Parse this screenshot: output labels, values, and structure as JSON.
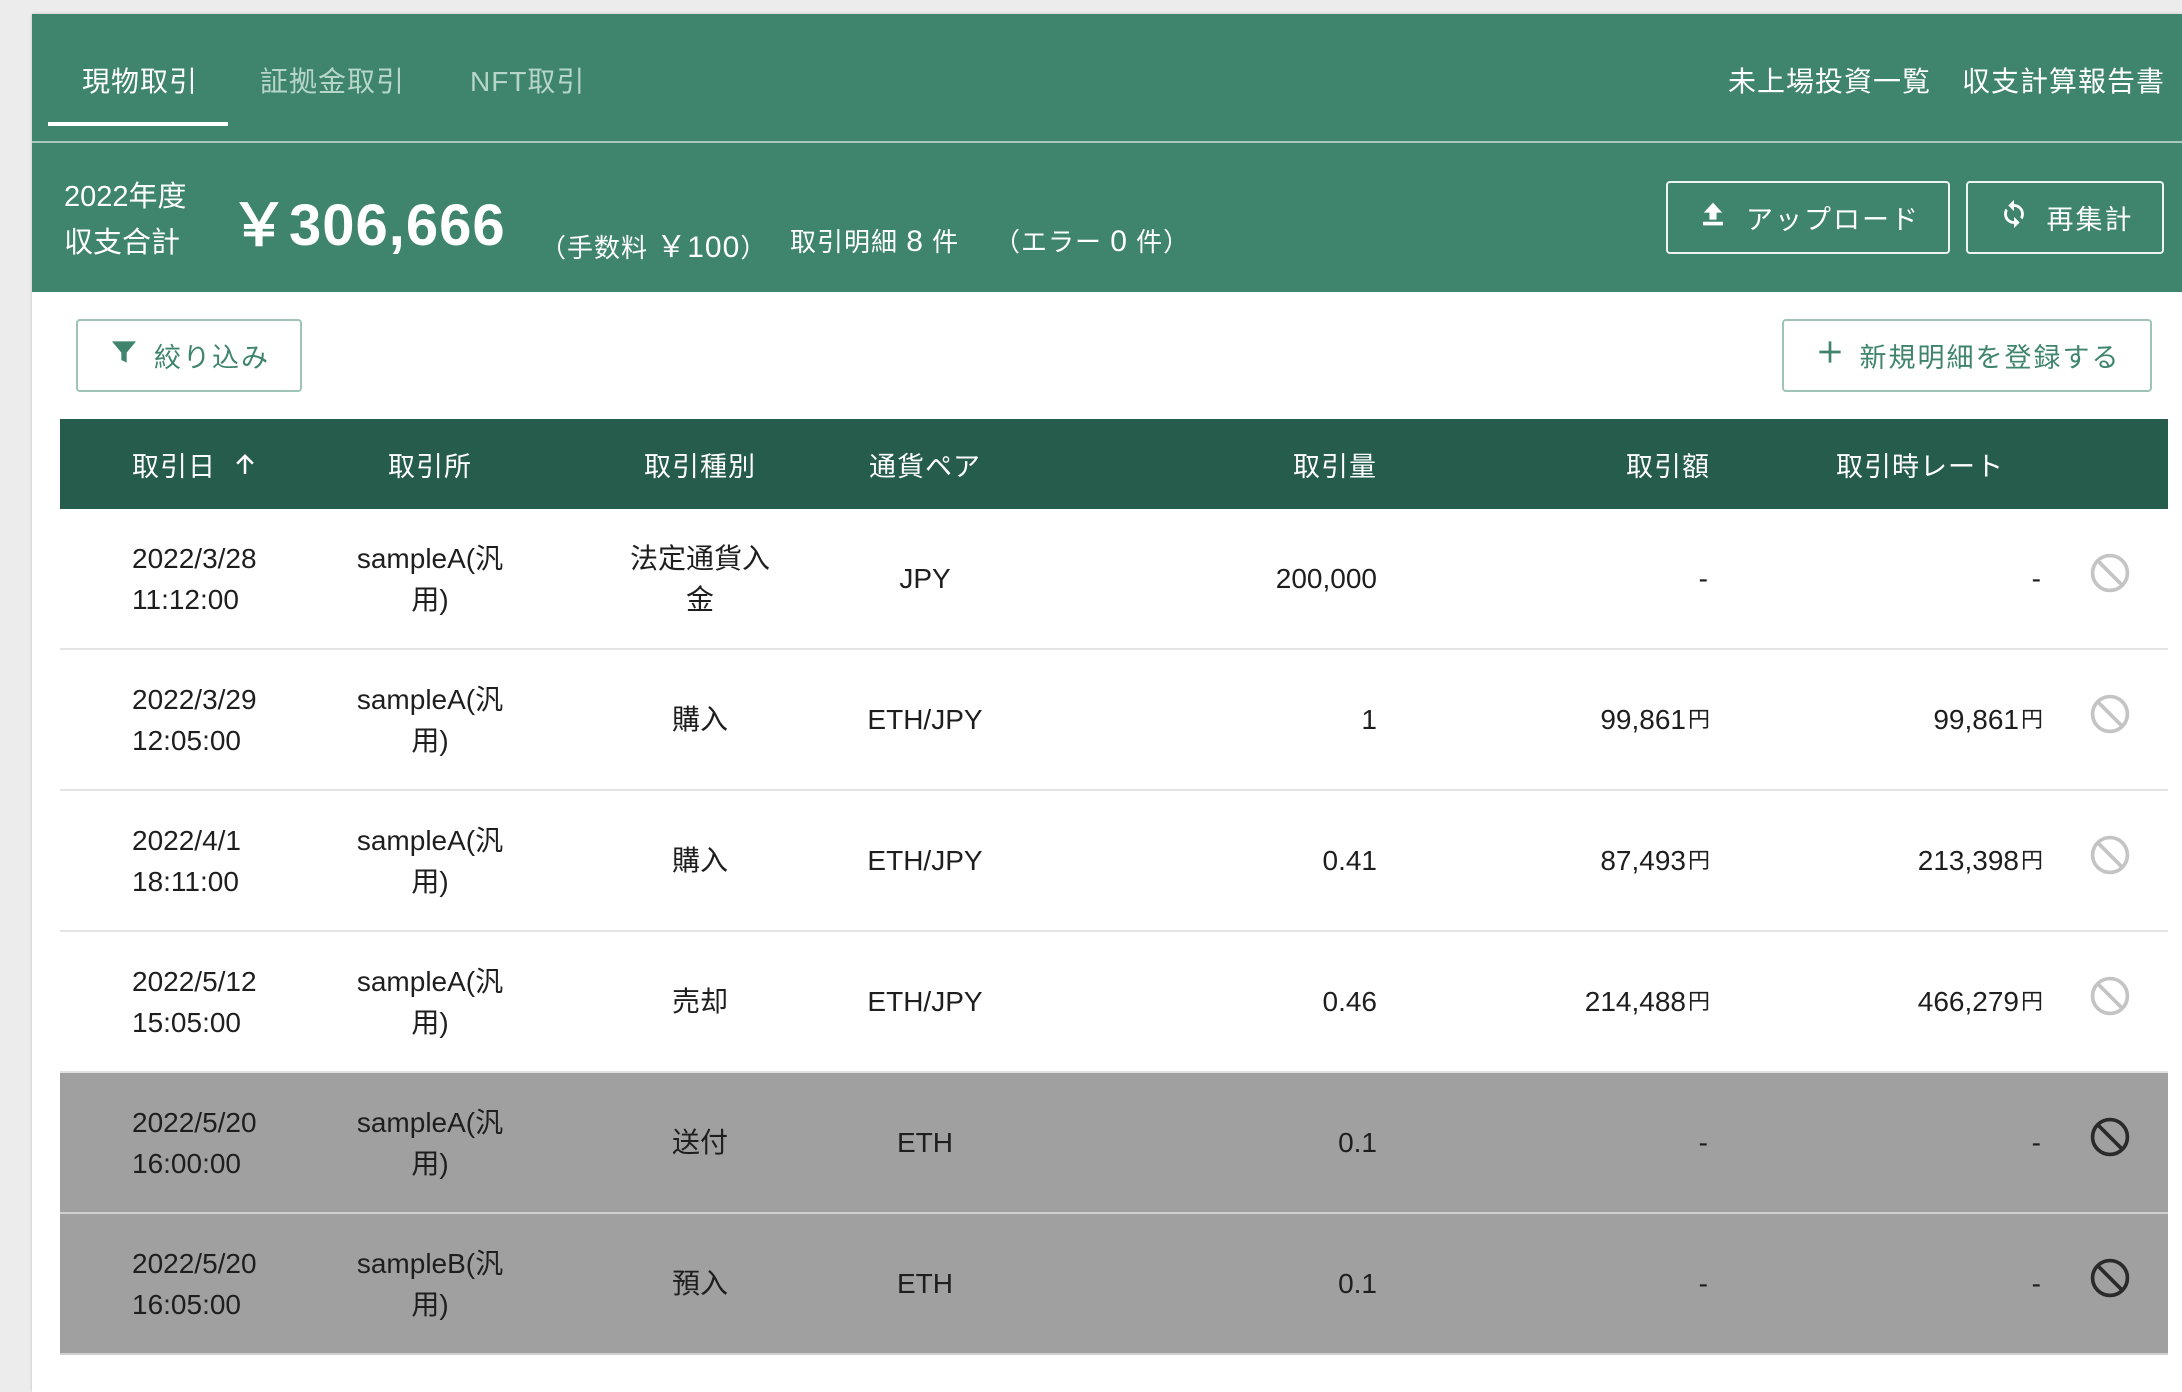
{
  "tabs": [
    {
      "label": "現物取引",
      "active": true
    },
    {
      "label": "証拠金取引",
      "active": false
    },
    {
      "label": "NFT取引",
      "active": false
    }
  ],
  "links": {
    "unlisted": "未上場投資一覧",
    "report": "収支計算報告書"
  },
  "summary": {
    "year_line1": "2022年度",
    "year_line2": "収支合計",
    "total": "￥306,666",
    "fee_prefix": "（手数料",
    "fee_value": "￥100",
    "fee_suffix": "）",
    "count_prefix": "取引明細",
    "count_value": "8",
    "count_suffix": "件",
    "error_prefix": "（エラー",
    "error_value": "0",
    "error_suffix": "件）"
  },
  "buttons": {
    "upload": "アップロード",
    "recalc": "再集計",
    "filter": "絞り込み",
    "add": "新規明細を登録する"
  },
  "table": {
    "headers": [
      "取引日",
      "取引所",
      "取引種別",
      "通貨ペア",
      "取引量",
      "取引額",
      "取引時レート"
    ],
    "rows": [
      {
        "date": "2022/3/28",
        "time": "11:12:00",
        "ex1": "sampleA(汎",
        "ex2": "用)",
        "type1": "法定通貨入",
        "type2": "金",
        "pair": "JPY",
        "qty": "200,000",
        "amt": "-",
        "amt_unit": "",
        "rate": "-",
        "rate_unit": "",
        "excluded": false
      },
      {
        "date": "2022/3/29",
        "time": "12:05:00",
        "ex1": "sampleA(汎",
        "ex2": "用)",
        "type1": "購入",
        "type2": "",
        "pair": "ETH/JPY",
        "qty": "1",
        "amt": "99,861",
        "amt_unit": "円",
        "rate": "99,861",
        "rate_unit": "円",
        "excluded": false
      },
      {
        "date": "2022/4/1",
        "time": "18:11:00",
        "ex1": "sampleA(汎",
        "ex2": "用)",
        "type1": "購入",
        "type2": "",
        "pair": "ETH/JPY",
        "qty": "0.41",
        "amt": "87,493",
        "amt_unit": "円",
        "rate": "213,398",
        "rate_unit": "円",
        "excluded": false
      },
      {
        "date": "2022/5/12",
        "time": "15:05:00",
        "ex1": "sampleA(汎",
        "ex2": "用)",
        "type1": "売却",
        "type2": "",
        "pair": "ETH/JPY",
        "qty": "0.46",
        "amt": "214,488",
        "amt_unit": "円",
        "rate": "466,279",
        "rate_unit": "円",
        "excluded": false
      },
      {
        "date": "2022/5/20",
        "time": "16:00:00",
        "ex1": "sampleA(汎",
        "ex2": "用)",
        "type1": "送付",
        "type2": "",
        "pair": "ETH",
        "qty": "0.1",
        "amt": "-",
        "amt_unit": "",
        "rate": "-",
        "rate_unit": "",
        "excluded": true
      },
      {
        "date": "2022/5/20",
        "time": "16:05:00",
        "ex1": "sampleB(汎",
        "ex2": "用)",
        "type1": "預入",
        "type2": "",
        "pair": "ETH",
        "qty": "0.1",
        "amt": "-",
        "amt_unit": "",
        "rate": "-",
        "rate_unit": "",
        "excluded": true
      }
    ]
  },
  "colors": {
    "header_bg": "#3f846d",
    "table_header_bg": "#265c4b",
    "excluded_row_bg": "#a0a0a0"
  },
  "icons": {
    "upload": "upload-icon",
    "recalc": "refresh-icon",
    "filter": "filter-icon",
    "add": "plus-icon",
    "sort": "arrow-up-icon",
    "exclude": "ban-icon"
  }
}
